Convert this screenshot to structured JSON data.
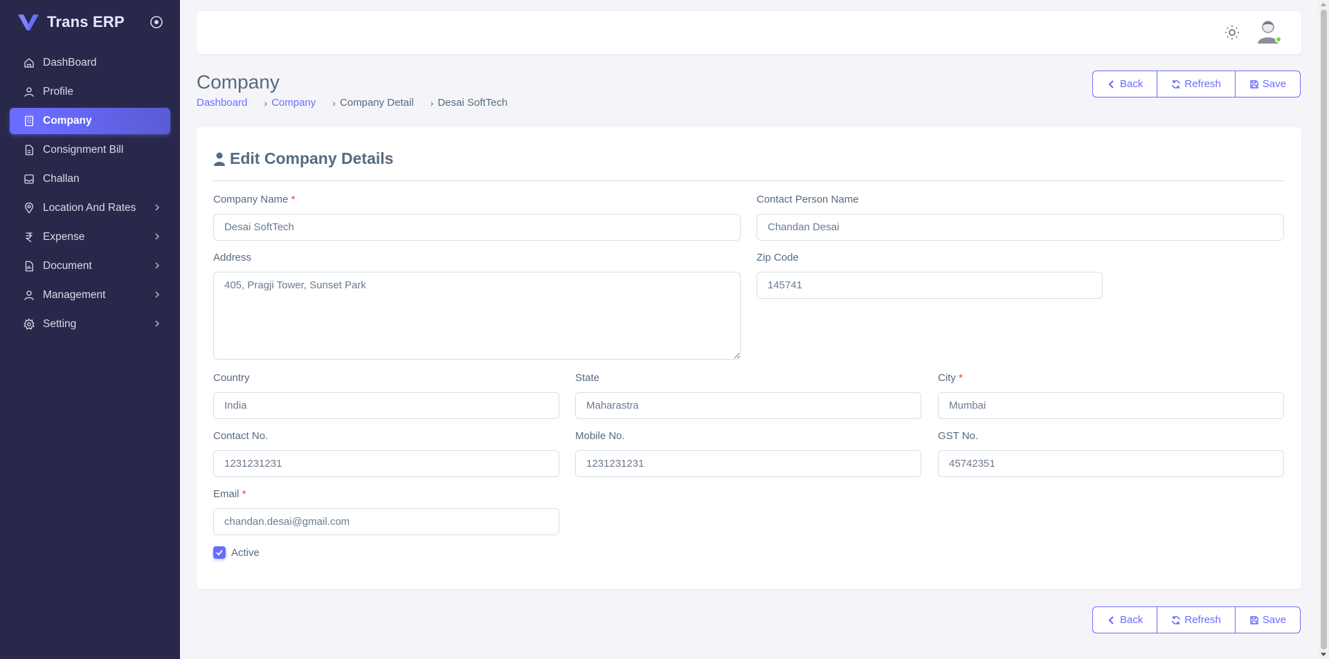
{
  "brand": {
    "name": "Trans ERP",
    "accent": "#696cff"
  },
  "sidebar": {
    "items": [
      {
        "label": "DashBoard",
        "icon": "home-icon"
      },
      {
        "label": "Profile",
        "icon": "user-icon"
      },
      {
        "label": "Company",
        "icon": "building-icon",
        "active": true
      },
      {
        "label": "Consignment Bill",
        "icon": "file-icon"
      },
      {
        "label": "Challan",
        "icon": "inbox-icon"
      },
      {
        "label": "Location And Rates",
        "icon": "map-pin-icon",
        "submenu": true
      },
      {
        "label": "Expense",
        "icon": "rupee-icon",
        "submenu": true
      },
      {
        "label": "Document",
        "icon": "document-icon",
        "submenu": true
      },
      {
        "label": "Management",
        "icon": "user-icon",
        "submenu": true
      },
      {
        "label": "Setting",
        "icon": "gear-icon",
        "submenu": true
      }
    ]
  },
  "header": {
    "title": "Company",
    "breadcrumb": [
      "Dashboard",
      "Company",
      "Company Detail",
      "Desai SoftTech"
    ]
  },
  "actions": {
    "back": "Back",
    "refresh": "Refresh",
    "save": "Save"
  },
  "form": {
    "title": "Edit Company Details",
    "company_name": {
      "label": "Company Name",
      "value": "Desai SoftTech"
    },
    "contact_person": {
      "label": "Contact Person Name",
      "value": "Chandan Desai"
    },
    "address": {
      "label": "Address",
      "value": "405, Pragji Tower, Sunset Park"
    },
    "zip_code": {
      "label": "Zip Code",
      "value": "145741"
    },
    "country": {
      "label": "Country",
      "value": "India"
    },
    "state": {
      "label": "State",
      "value": "Maharastra"
    },
    "city": {
      "label": "City",
      "value": "Mumbai"
    },
    "contact_no": {
      "label": "Contact No.",
      "value": "1231231231"
    },
    "mobile_no": {
      "label": "Mobile No.",
      "value": "1231231231"
    },
    "gst_no": {
      "label": "GST No.",
      "value": "45742351"
    },
    "email": {
      "label": "Email",
      "value": "chandan.desai@gmail.com"
    },
    "active": {
      "label": "Active",
      "checked": true
    }
  },
  "required_marker": "*"
}
